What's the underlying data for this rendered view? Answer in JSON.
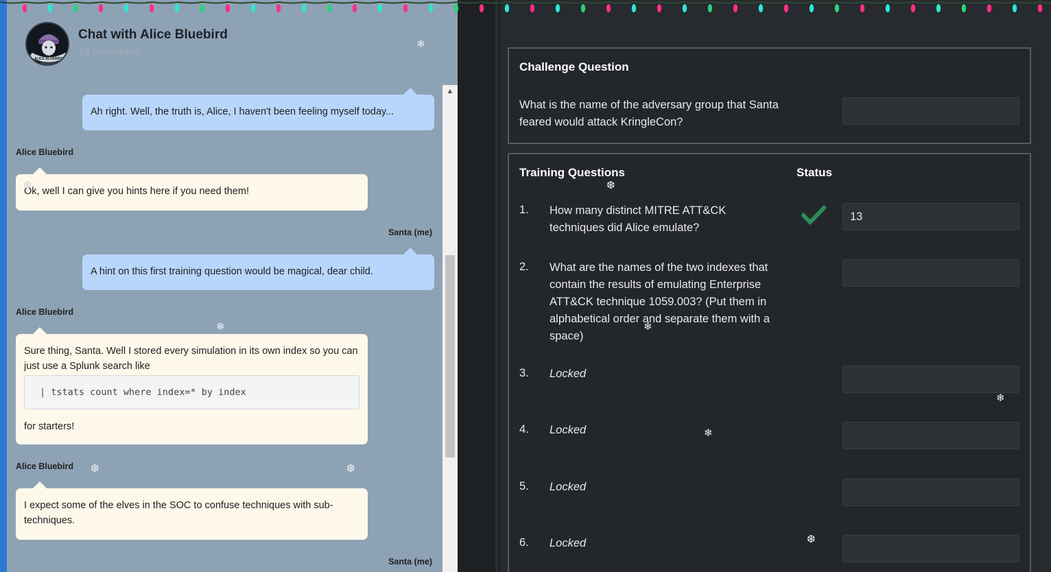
{
  "chat": {
    "title": "Chat with Alice Bluebird",
    "message_count": "15 messages",
    "avatar_label": "ALICE BLUEBIRD",
    "messages": [
      {
        "sender": "",
        "text": "Ah right. Well, the truth is, Alice, I haven't been feeling myself today..."
      },
      {
        "sender": "Alice Bluebird",
        "text": "Ok, well I can give you hints here if you need them!"
      },
      {
        "sender": "Santa (me)",
        "text": "A hint on this first training question would be magical, dear child."
      },
      {
        "sender": "Alice Bluebird",
        "text": "Sure thing, Santa. Well I stored every simulation in its own index so you can just use a Splunk search like",
        "code": "| tstats count where index=* by index",
        "after": "for starters!"
      },
      {
        "sender": "Alice Bluebird",
        "text": "I expect some of the elves in the SOC to confuse techniques with sub-techniques."
      },
      {
        "sender": "Santa (me)",
        "text": ""
      }
    ]
  },
  "challenge": {
    "title": "Challenge Question",
    "question": "What is the name of the adversary group that Santa feared would attack KringleCon?",
    "answer": ""
  },
  "training": {
    "title": "Training Questions",
    "status_header": "Status",
    "questions": [
      {
        "num": "1.",
        "text": "How many distinct MITRE ATT&CK techniques did Alice emulate?",
        "answer": "13",
        "status": "check-icon"
      },
      {
        "num": "2.",
        "text": "What are the names of the two indexes that contain the results of emulating Enterprise ATT&CK technique 1059.003? (Put them in alphabetical order and separate them with a space)",
        "answer": ""
      },
      {
        "num": "3.",
        "text": "Locked",
        "answer": ""
      },
      {
        "num": "4.",
        "text": "Locked",
        "answer": ""
      },
      {
        "num": "5.",
        "text": "Locked",
        "answer": ""
      },
      {
        "num": "6.",
        "text": "Locked",
        "answer": ""
      }
    ]
  },
  "colors": {
    "chat_bg": "#8ea2b5",
    "my_bubble": "#b8d6fb",
    "their_bubble": "#fef8ea",
    "quiz_bg": "#272a2e",
    "check": "#2e8b57",
    "lights": [
      "#ff2d8a",
      "#2ee6d6",
      "#27d37c",
      "#ff2d8a",
      "#2ee6d6"
    ]
  },
  "decor": {
    "snowflake": "❄",
    "snowflake_alt": "❆"
  }
}
